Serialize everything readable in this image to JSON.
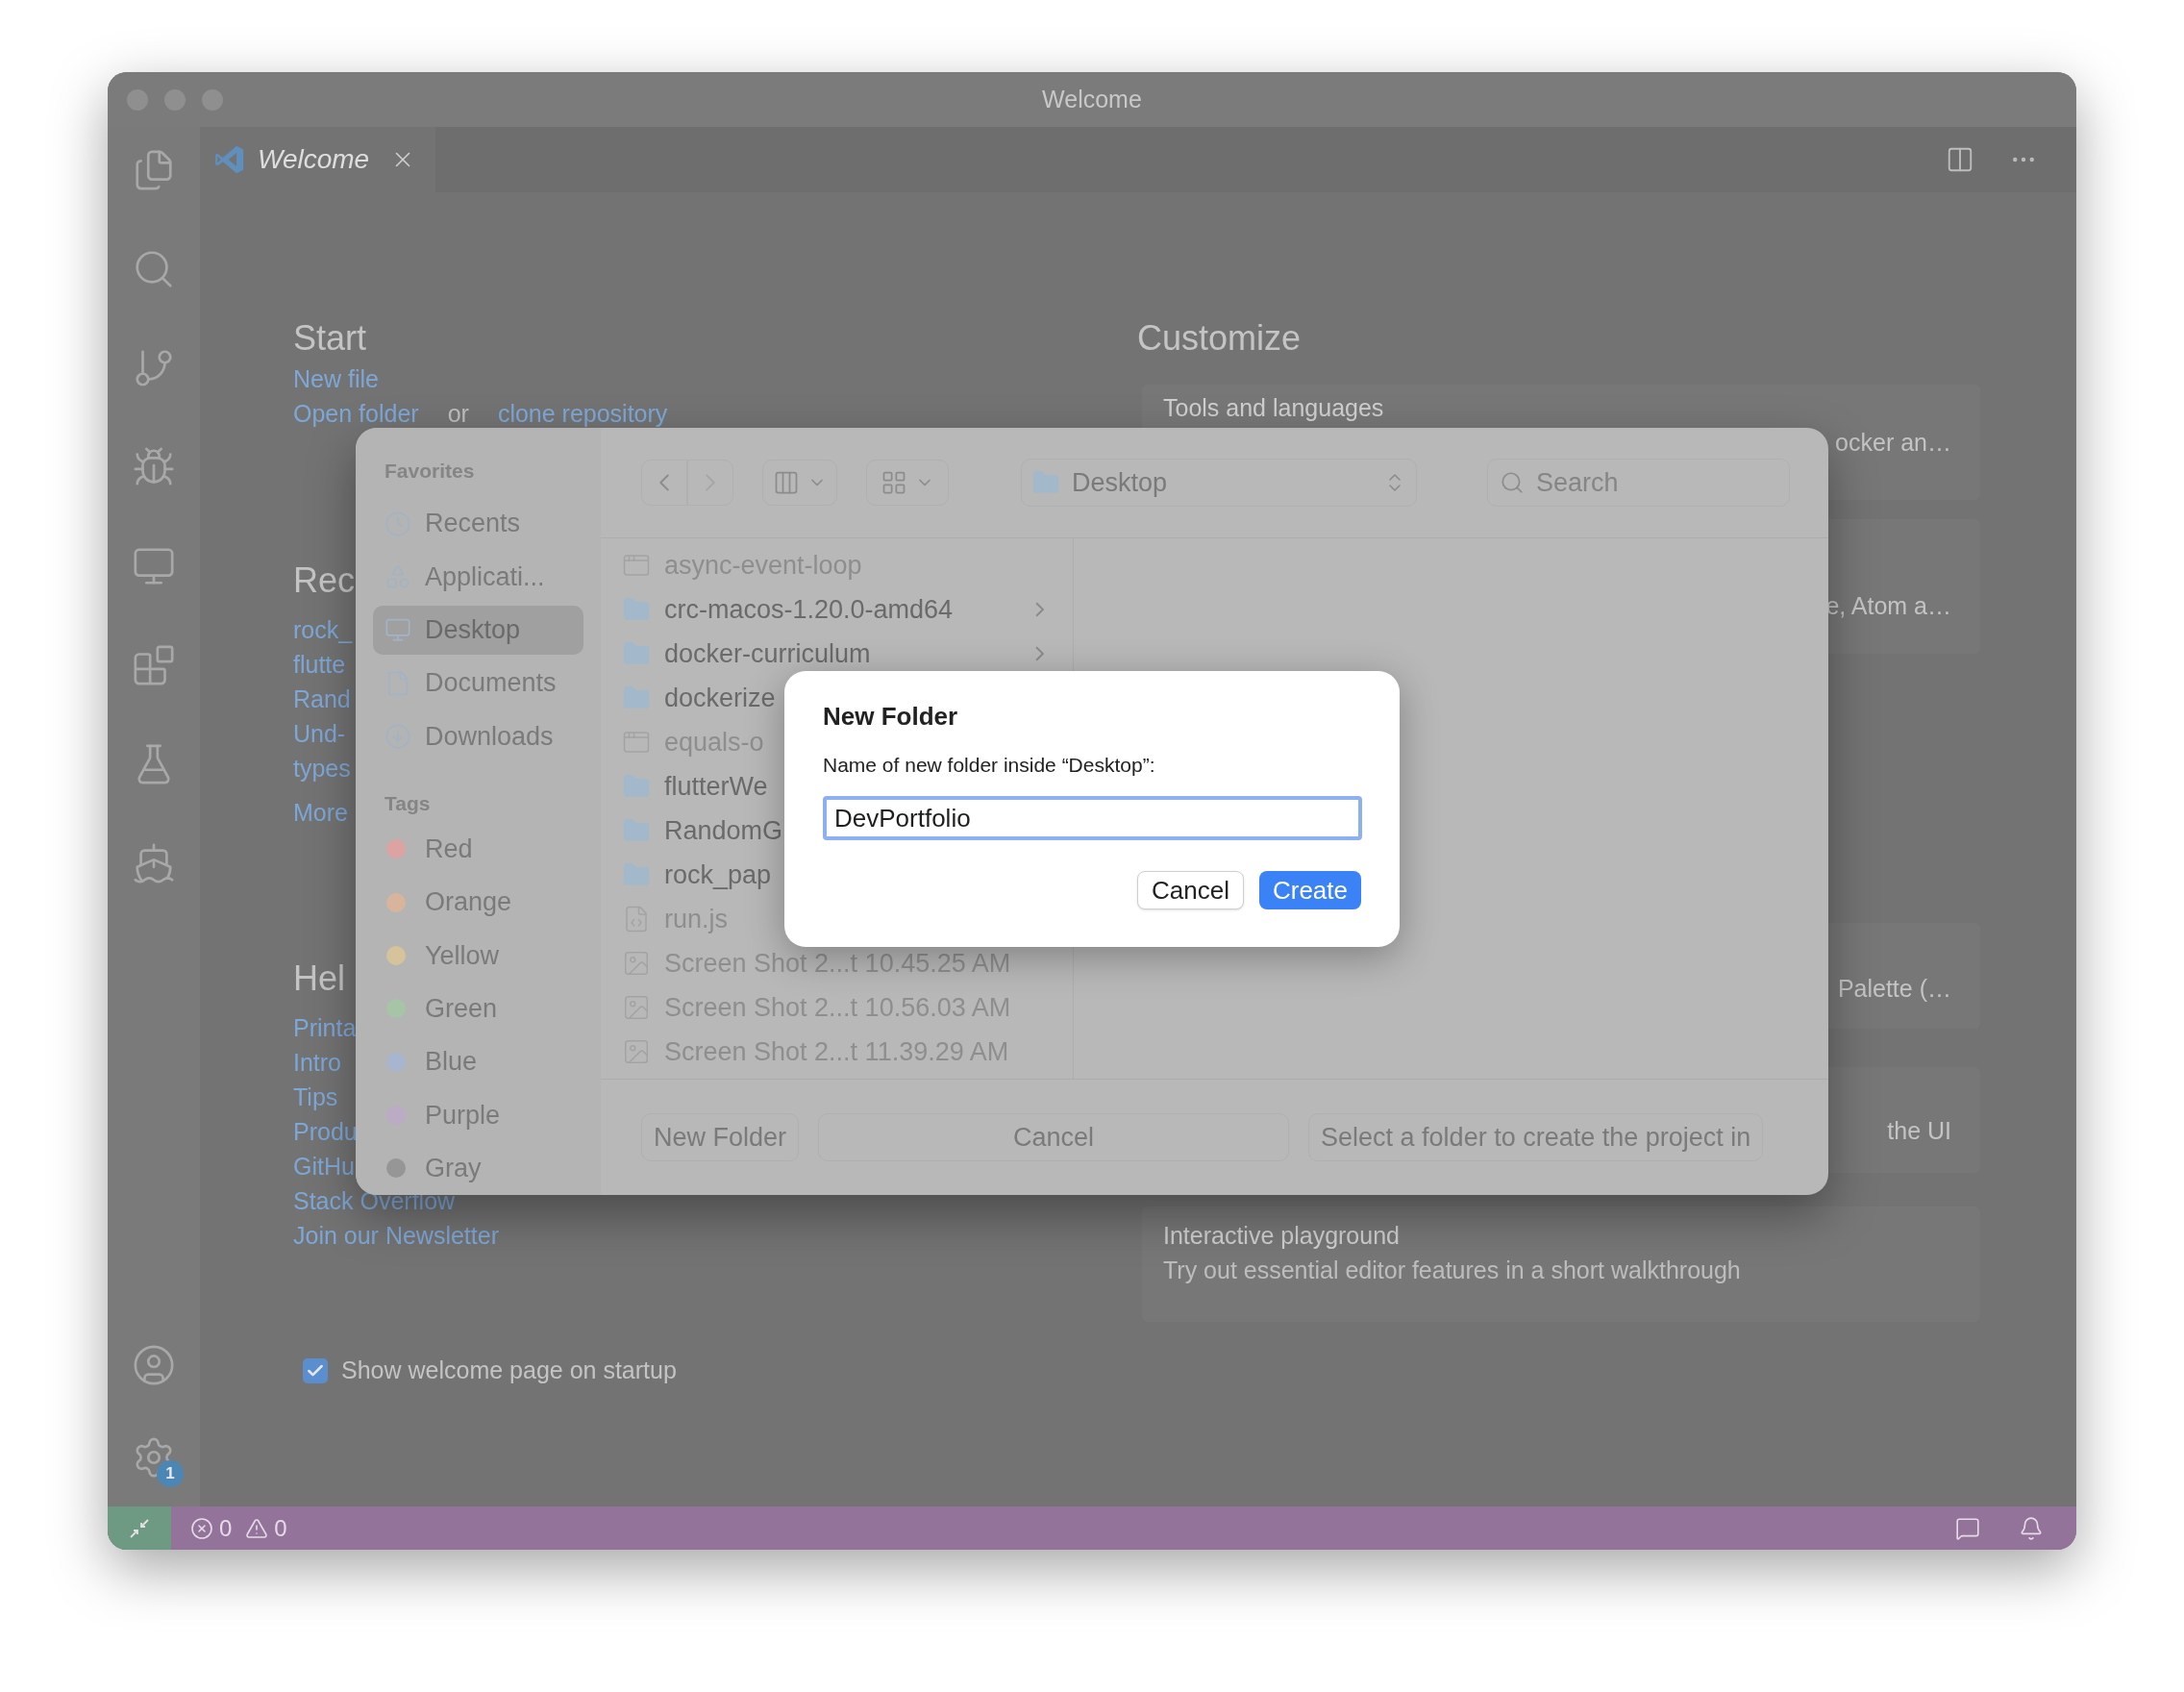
{
  "window": {
    "title": "Welcome"
  },
  "activity_bar": {
    "settings_badge": "1"
  },
  "tabs": [
    {
      "label": "Welcome",
      "selected": true
    }
  ],
  "start": {
    "heading": "Start",
    "lines": [
      [
        {
          "text": "New file",
          "kind": "link"
        }
      ],
      [
        {
          "text": "Open folder",
          "kind": "link"
        },
        {
          "text": "or",
          "kind": "text"
        },
        {
          "text": "clone repository",
          "kind": "link"
        }
      ]
    ]
  },
  "recent": {
    "heading": "Rec",
    "items": [
      "rock_",
      "flutte",
      "Rand",
      "Und-",
      "types"
    ],
    "more": "More"
  },
  "help": {
    "heading": "Hel",
    "links": [
      "Printa",
      "Intro",
      "Tips",
      "Produ",
      "GitHu",
      "Stack Overflow",
      "Join our Newsletter"
    ]
  },
  "customize": {
    "heading": "Customize",
    "cards": [
      {
        "title": "Tools and languages",
        "fragment": "ocker an…"
      },
      {
        "fragment": "e, Atom a…"
      },
      {
        "fragment": "Palette (…"
      },
      {
        "fragment": "the UI"
      },
      {
        "title": "Interactive playground",
        "description": "Try out essential editor features in a short walkthrough"
      }
    ]
  },
  "startup_option": {
    "label": "Show welcome page on startup",
    "checked": true
  },
  "status_bar": {
    "errors": "0",
    "warnings": "0"
  },
  "open_dialog": {
    "favorites_header": "Favorites",
    "favorites": [
      {
        "label": "Recents",
        "kind": "recents",
        "selected": false
      },
      {
        "label": "Applicati...",
        "kind": "applications",
        "selected": false
      },
      {
        "label": "Desktop",
        "kind": "desktop",
        "selected": true
      },
      {
        "label": "Documents",
        "kind": "documents",
        "selected": false
      },
      {
        "label": "Downloads",
        "kind": "downloads",
        "selected": false
      }
    ],
    "tags_header": "Tags",
    "tags": [
      {
        "label": "Red",
        "color": "#dca3a3"
      },
      {
        "label": "Orange",
        "color": "#d9b49c"
      },
      {
        "label": "Yellow",
        "color": "#d6c39c"
      },
      {
        "label": "Green",
        "color": "#a6c4a6"
      },
      {
        "label": "Blue",
        "color": "#a7b6ce"
      },
      {
        "label": "Purple",
        "color": "#bcabc4"
      },
      {
        "label": "Gray",
        "color": "#969696"
      }
    ],
    "location": "Desktop",
    "search": {
      "placeholder": "Search"
    },
    "files": [
      {
        "name": "async-event-loop",
        "kind": "executable",
        "disabled": true,
        "expandable": false
      },
      {
        "name": "crc-macos-1.20.0-amd64",
        "kind": "folder",
        "disabled": false,
        "expandable": true
      },
      {
        "name": "docker-curriculum",
        "kind": "folder",
        "disabled": false,
        "expandable": true
      },
      {
        "name": "dockerize",
        "kind": "folder",
        "disabled": false,
        "expandable": false
      },
      {
        "name": "equals-o",
        "kind": "executable",
        "disabled": true,
        "expandable": false
      },
      {
        "name": "flutterWe",
        "kind": "folder",
        "disabled": false,
        "expandable": false
      },
      {
        "name": "RandomG",
        "kind": "folder",
        "disabled": false,
        "expandable": false
      },
      {
        "name": "rock_pap",
        "kind": "folder",
        "disabled": false,
        "expandable": false
      },
      {
        "name": "run.js",
        "kind": "script",
        "disabled": true,
        "expandable": false
      },
      {
        "name": "Screen Shot 2...t 10.45.25 AM",
        "kind": "image",
        "disabled": true,
        "expandable": false
      },
      {
        "name": "Screen Shot 2...t 10.56.03 AM",
        "kind": "image",
        "disabled": true,
        "expandable": false
      },
      {
        "name": "Screen Shot 2...t 11.39.29 AM",
        "kind": "image",
        "disabled": true,
        "expandable": false
      }
    ],
    "buttons": [
      "New Folder",
      "Cancel",
      "Select a folder to create the project in"
    ]
  },
  "new_folder_sheet": {
    "title": "New Folder",
    "prompt": "Name of new folder inside “Desktop”:",
    "value": "DevPortfolio",
    "buttons": [
      {
        "label": "Cancel",
        "kind": "normal"
      },
      {
        "label": "Create",
        "kind": "default"
      }
    ]
  }
}
